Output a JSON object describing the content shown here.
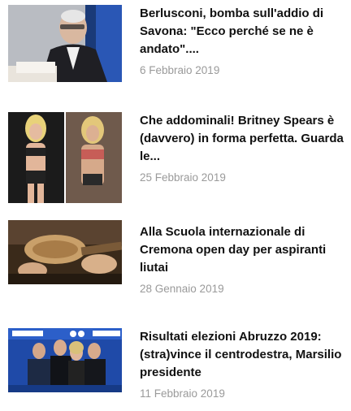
{
  "articles": [
    {
      "title": "Berlusconi, bomba sull'addio di Savona: \"Ecco perché se ne è andato\"....",
      "date": "6 Febbraio 2019",
      "image_icon": "portrait-photo",
      "image_colors": {
        "bg": "#1a3a78",
        "accent": "#e9e4dc"
      }
    },
    {
      "title": "Che addominali! Britney Spears è (davvero) in forma perfetta. Guarda le...",
      "date": "25 Febbraio 2019",
      "image_icon": "two-photos",
      "image_colors": {
        "bg": "#1b1b1b",
        "accent": "#d6a98a"
      }
    },
    {
      "title": "Alla Scuola internazionale di Cremona open day per aspiranti liutai",
      "date": "28 Gennaio 2019",
      "image_icon": "workshop-photo",
      "image_colors": {
        "bg": "#3a2a1a",
        "accent": "#c9a06a"
      }
    },
    {
      "title": "Risultati elezioni Abruzzo 2019: (stra)vince il centrodestra, Marsilio presidente",
      "date": "11 Febbraio 2019",
      "image_icon": "group-photo",
      "image_colors": {
        "bg": "#1f4aa8",
        "accent": "#ffffff"
      }
    }
  ]
}
